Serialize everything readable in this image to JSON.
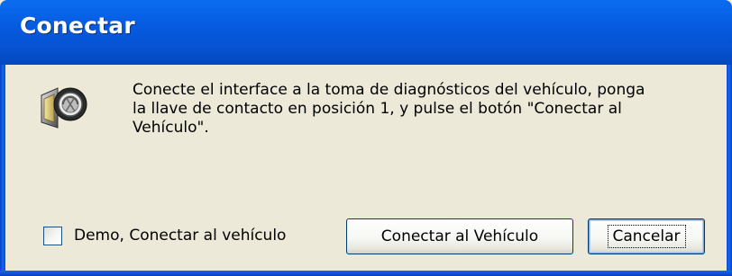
{
  "window": {
    "title": "Conectar"
  },
  "dialog": {
    "icon": "diagnostic-connector-icon",
    "message": "Conecte el interface a la toma de diagnósticos del vehículo, ponga\nla llave de contacto en posición 1, y pulse el botón \"Conectar al\nVehículo\"."
  },
  "demo_checkbox": {
    "label": "Demo, Conectar al vehículo",
    "checked": false
  },
  "buttons": {
    "connect_label": "Conectar al Vehículo",
    "cancel_label": "Cancelar"
  },
  "colors": {
    "titlebar": "#0659de",
    "face": "#ece9d8",
    "button_border": "#003c74"
  }
}
